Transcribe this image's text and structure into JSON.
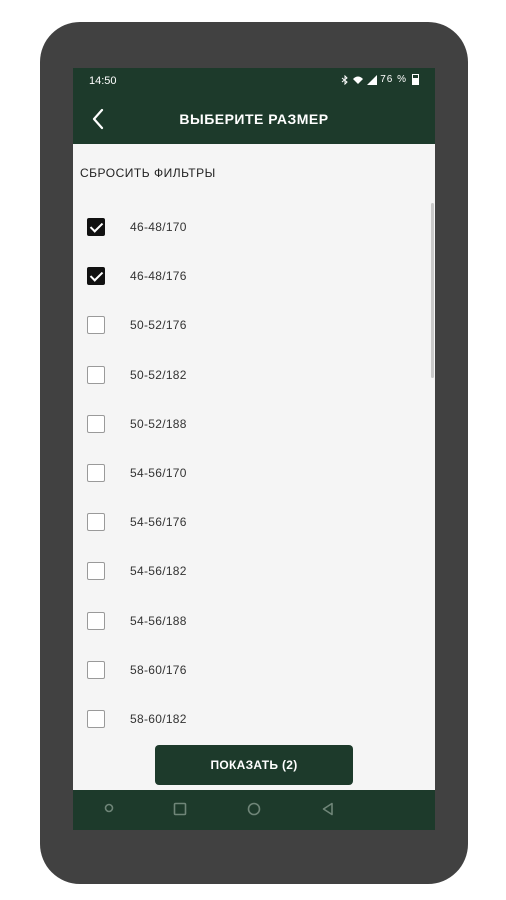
{
  "status_bar": {
    "time": "14:50",
    "icons": [
      "bluetooth-icon",
      "wifi-icon",
      "signal-icon"
    ],
    "battery_text": "76 %"
  },
  "app_bar": {
    "back_icon": "chevron-left-icon",
    "title": "ВЫБЕРИТЕ РАЗМЕР"
  },
  "filters": {
    "reset_label": "СБРОСИТЬ ФИЛЬТРЫ",
    "items": [
      {
        "label": "46-48/170",
        "checked": true
      },
      {
        "label": "46-48/176",
        "checked": true
      },
      {
        "label": "50-52/176",
        "checked": false
      },
      {
        "label": "50-52/182",
        "checked": false
      },
      {
        "label": "50-52/188",
        "checked": false
      },
      {
        "label": "54-56/170",
        "checked": false
      },
      {
        "label": "54-56/176",
        "checked": false
      },
      {
        "label": "54-56/182",
        "checked": false
      },
      {
        "label": "54-56/188",
        "checked": false
      },
      {
        "label": "58-60/176",
        "checked": false
      },
      {
        "label": "58-60/182",
        "checked": false
      }
    ]
  },
  "footer": {
    "show_button_label": "ПОКАЗАТЬ (2)"
  },
  "nav_bar": {
    "icons": [
      "dot-icon",
      "square-icon",
      "circle-icon",
      "triangle-back-icon"
    ]
  },
  "colors": {
    "brand": "#1d3a2b",
    "phone": "#414141",
    "background": "#f5f5f5"
  }
}
